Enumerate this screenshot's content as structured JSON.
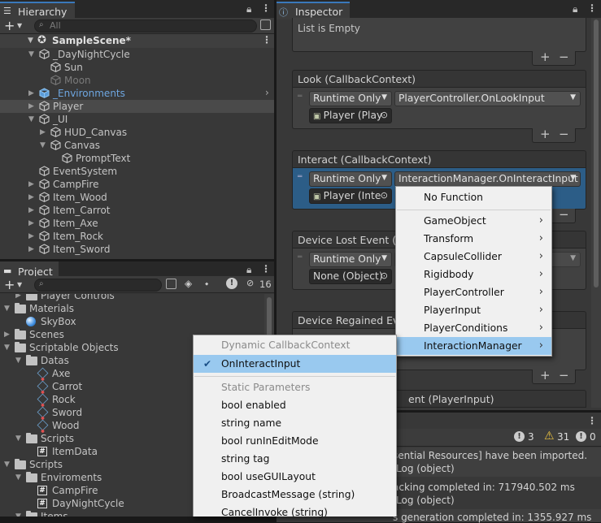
{
  "hierarchy": {
    "tab": "Hierarchy",
    "search_placeholder": "All",
    "scene": "SampleScene*",
    "items": [
      {
        "label": "_DayNightCycle"
      },
      {
        "label": "Sun"
      },
      {
        "label": "Moon"
      },
      {
        "label": "_Environments"
      },
      {
        "label": "Player"
      },
      {
        "label": "_UI"
      },
      {
        "label": "HUD_Canvas"
      },
      {
        "label": "Canvas"
      },
      {
        "label": "PromptText"
      },
      {
        "label": "EventSystem"
      },
      {
        "label": "CampFire"
      },
      {
        "label": "Item_Wood"
      },
      {
        "label": "Item_Carrot"
      },
      {
        "label": "Item_Axe"
      },
      {
        "label": "Item_Rock"
      },
      {
        "label": "Item_Sword"
      }
    ]
  },
  "project": {
    "tab": "Project",
    "hidden_count": "16",
    "items": [
      {
        "label": "Player Controls"
      },
      {
        "label": "Materials"
      },
      {
        "label": "SkyBox"
      },
      {
        "label": "Scenes"
      },
      {
        "label": "Scriptable Objects"
      },
      {
        "label": "Datas"
      },
      {
        "label": "Axe"
      },
      {
        "label": "Carrot"
      },
      {
        "label": "Rock"
      },
      {
        "label": "Sword"
      },
      {
        "label": "Wood"
      },
      {
        "label": "Scripts"
      },
      {
        "label": "ItemData"
      },
      {
        "label": "Scripts"
      },
      {
        "label": "Enviroments"
      },
      {
        "label": "CampFire"
      },
      {
        "label": "DayNightCycle"
      },
      {
        "label": "Items"
      }
    ]
  },
  "inspector": {
    "tab": "Inspector",
    "list_empty": "List is Empty",
    "look": {
      "title": "Look (CallbackContext)",
      "mode": "Runtime Only",
      "func": "PlayerController.OnLookInput",
      "obj": "Player (Play"
    },
    "interact": {
      "title": "Interact (CallbackContext)",
      "mode": "Runtime Only",
      "func": "InteractionManager.OnInteractInput",
      "obj": "Player (Inte"
    },
    "lost": {
      "title": "Device Lost Event (Pl",
      "mode": "Runtime Only",
      "obj": "None (Object)"
    },
    "regained": {
      "title": "Device Regained Eve"
    },
    "last": {
      "title": "ent (PlayerInput)"
    }
  },
  "console": {
    "warn_count": "3",
    "caution_count": "31",
    "error_count": "0",
    "lines": [
      "sential Resources] have been imported.",
      ":Log (object)",
      "acking completed in: 717940.502 ms",
      ":Log (object)",
      "s generation completed in: 1355.927 ms"
    ]
  },
  "component_menu": {
    "items": [
      {
        "label": "No Function"
      },
      {
        "label": "GameObject"
      },
      {
        "label": "Transform"
      },
      {
        "label": "CapsuleCollider"
      },
      {
        "label": "Rigidbody"
      },
      {
        "label": "PlayerController"
      },
      {
        "label": "PlayerInput"
      },
      {
        "label": "PlayerConditions"
      },
      {
        "label": "InteractionManager"
      }
    ]
  },
  "method_menu": {
    "header_dynamic": "Dynamic CallbackContext",
    "selected": "OnInteractInput",
    "header_static": "Static Parameters",
    "items": [
      {
        "label": "bool enabled"
      },
      {
        "label": "string name"
      },
      {
        "label": "bool runInEditMode"
      },
      {
        "label": "string tag"
      },
      {
        "label": "bool useGUILayout"
      },
      {
        "label": "BroadcastMessage (string)"
      },
      {
        "label": "CancelInvoke (string)"
      }
    ]
  },
  "colors": {
    "accent": "#3a79bb",
    "selected_menu": "#99c9ef",
    "panel": "#383838",
    "prefab_blue": "#6ea6e0"
  }
}
